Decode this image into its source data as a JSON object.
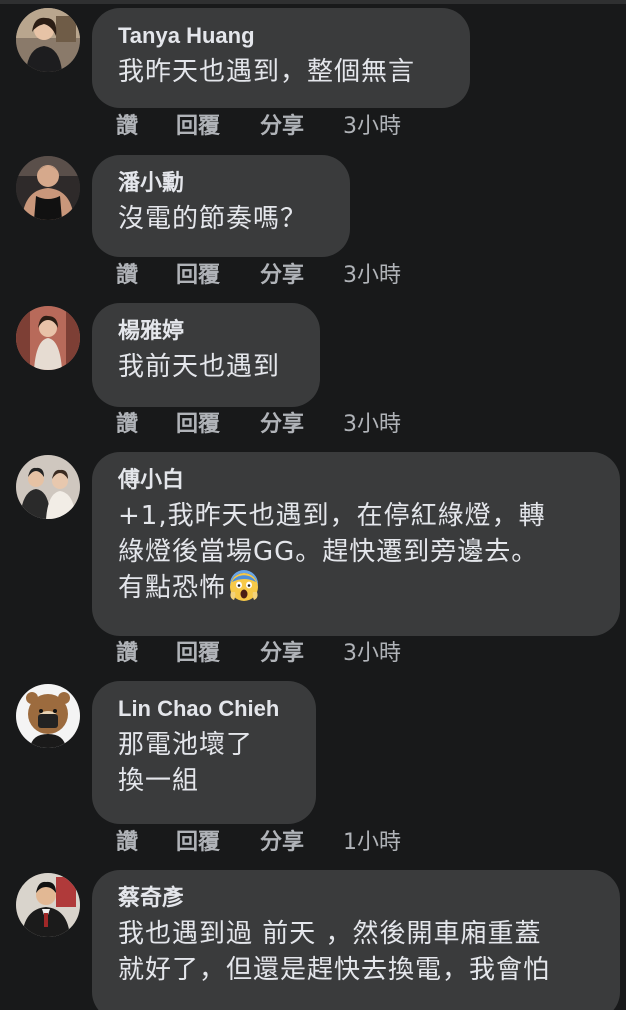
{
  "actions": {
    "like": "讚",
    "reply": "回覆",
    "share": "分享"
  },
  "comments": [
    {
      "author": "Tanya Huang",
      "lines": [
        "我昨天也遇到，整個無言"
      ],
      "time": "3小時",
      "avatar_icon": "avatar-photo-icon"
    },
    {
      "author": "潘小勳",
      "lines": [
        "沒電的節奏嗎？"
      ],
      "time": "3小時",
      "avatar_icon": "avatar-photo-icon"
    },
    {
      "author": "楊雅婷",
      "lines": [
        "我前天也遇到"
      ],
      "time": "3小時",
      "avatar_icon": "avatar-photo-icon"
    },
    {
      "author": "傅小白",
      "lines": [
        "+1,我昨天也遇到，在停紅綠燈，轉",
        "綠燈後當場GG。趕快遷到旁邊去。",
        "有點恐怖"
      ],
      "emoji": "screaming-face-emoji",
      "time": "3小時",
      "avatar_icon": "avatar-photo-icon"
    },
    {
      "author": "Lin Chao Chieh",
      "lines": [
        "那電池壞了",
        "換一組"
      ],
      "time": "1小時",
      "avatar_icon": "avatar-photo-icon"
    },
    {
      "author": "蔡奇彥",
      "lines": [
        "我也遇到過 前天 ，然後開車廂重蓋",
        "就好了，但還是趕快去換電，我會怕"
      ],
      "avatar_icon": "avatar-photo-icon"
    }
  ]
}
